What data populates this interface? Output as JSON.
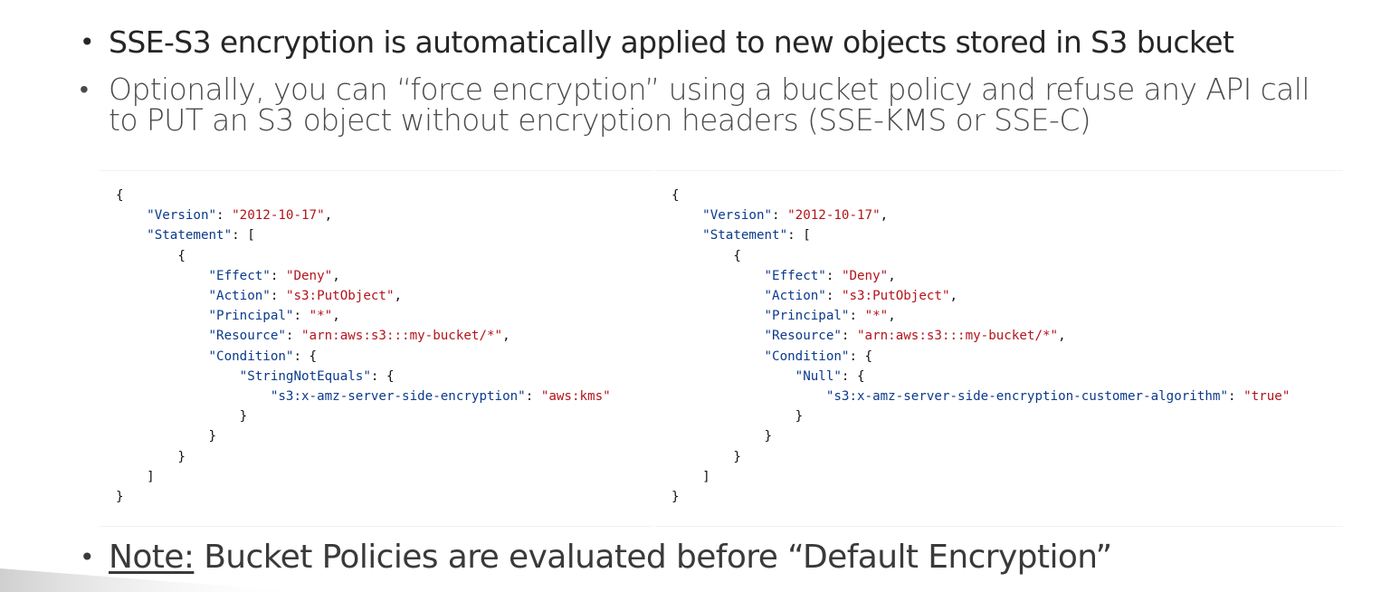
{
  "bullets": {
    "first": "SSE-S3 encryption is automatically applied to new objects stored in S3 bucket",
    "second_line1": "Optionally, you can “force encryption” using a bucket policy and refuse any API call",
    "second_line2": "to PUT an S3 object without encryption headers (SSE-KMS or SSE-C)",
    "note_label": "Note:",
    "note_text": " Bucket Policies are evaluated before “Default Encryption”",
    "dot": "•"
  },
  "policy_left": {
    "version_key": "\"Version\"",
    "version_value": "\"2012-10-17\"",
    "statement_key": "\"Statement\"",
    "effect_key": "\"Effect\"",
    "effect_value": "\"Deny\"",
    "action_key": "\"Action\"",
    "action_value": "\"s3:PutObject\"",
    "principal_key": "\"Principal\"",
    "principal_value": "\"*\"",
    "resource_key": "\"Resource\"",
    "resource_value": "\"arn:aws:s3:::my-bucket/*\"",
    "condition_key": "\"Condition\"",
    "operator_key": "\"StringNotEquals\"",
    "header_key": "\"s3:x-amz-server-side-encryption\"",
    "header_value": "\"aws:kms\""
  },
  "policy_right": {
    "version_key": "\"Version\"",
    "version_value": "\"2012-10-17\"",
    "statement_key": "\"Statement\"",
    "effect_key": "\"Effect\"",
    "effect_value": "\"Deny\"",
    "action_key": "\"Action\"",
    "action_value": "\"s3:PutObject\"",
    "principal_key": "\"Principal\"",
    "principal_value": "\"*\"",
    "resource_key": "\"Resource\"",
    "resource_value": "\"arn:aws:s3:::my-bucket/*\"",
    "condition_key": "\"Condition\"",
    "operator_key": "\"Null\"",
    "header_key": "\"s3:x-amz-server-side-encryption-customer-algorithm\"",
    "header_value": "\"true\""
  },
  "colors": {
    "json_key": "#0b3a8c",
    "json_string": "#b3141b",
    "bullet_text": "#262626"
  }
}
